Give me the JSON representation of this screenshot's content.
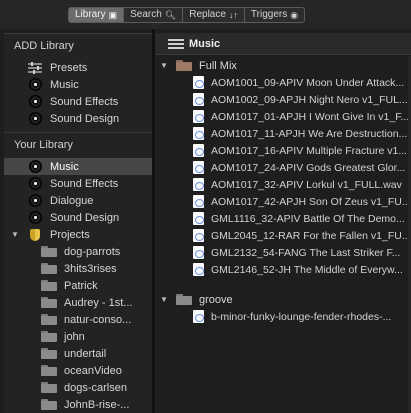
{
  "toolbar": {
    "tabs": [
      {
        "label": "Library",
        "icon": "library-icon",
        "active": true
      },
      {
        "label": "Search",
        "icon": "search-icon",
        "active": false
      },
      {
        "label": "Replace",
        "icon": "sort-arrows-icon",
        "active": false
      },
      {
        "label": "Triggers",
        "icon": "trigger-icon",
        "active": false
      }
    ]
  },
  "sidebar": {
    "add_library_title": "ADD Library",
    "add_library_items": [
      {
        "label": "Presets",
        "icon": "sliders-icon"
      },
      {
        "label": "Music",
        "icon": "vinyl-icon"
      },
      {
        "label": "Sound Effects",
        "icon": "vinyl-icon"
      },
      {
        "label": "Sound Design",
        "icon": "vinyl-icon"
      }
    ],
    "your_library_title": "Your Library",
    "your_library_items": [
      {
        "label": "Music",
        "icon": "vinyl-icon",
        "selected": true
      },
      {
        "label": "Sound Effects",
        "icon": "vinyl-icon"
      },
      {
        "label": "Dialogue",
        "icon": "vinyl-icon"
      },
      {
        "label": "Sound Design",
        "icon": "vinyl-icon"
      }
    ],
    "projects_label": "Projects",
    "projects": [
      "dog-parrots",
      "3hits3rises",
      "Patrick",
      "Audrey - 1st...",
      "natur-conso...",
      "john",
      "undertail",
      "oceanVideo",
      "dogs-carlsen",
      "JohnB-rise-..."
    ]
  },
  "main": {
    "title": "Music",
    "groups": [
      {
        "name": "Full Mix",
        "files": [
          "AOM1001_09-APIV Moon Under Attack...",
          "AOM1002_09-APJH Night Nero v1_FUL...",
          "AOM1017_01-APJH I Wont Give In v1_F...",
          "AOM1017_11-APJH We Are Destruction...",
          "AOM1017_16-APIV Multiple Fracture v1...",
          "AOM1017_24-APIV Gods Greatest Glor...",
          "AOM1017_32-APIV Lorkul v1_FULL.wav",
          "AOM1017_42-APJH Son Of Zeus v1_FU...",
          "GML1116_32-APIV Battle Of The Demo...",
          "GML2045_12-RAR For the Fallen v1_FU...",
          "GML2132_54-FANG The Last Striker F...",
          "GML2146_52-JH The Middle of Everyw..."
        ]
      },
      {
        "name": "groove",
        "files": [
          "b-minor-funky-lounge-fender-rhodes-..."
        ]
      }
    ]
  }
}
